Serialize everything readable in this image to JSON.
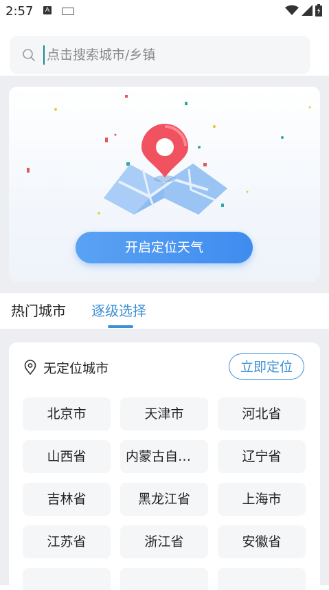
{
  "status": {
    "time": "2:57",
    "notification_icon_a": "A"
  },
  "search": {
    "placeholder": "点击搜索城市/乡镇"
  },
  "locate_card": {
    "button_label": "开启定位天气"
  },
  "tabs": [
    {
      "label": "热门城市",
      "active": false
    },
    {
      "label": "逐级选择",
      "active": true
    }
  ],
  "location": {
    "label": "无定位城市",
    "button_label": "立即定位"
  },
  "regions": [
    "北京市",
    "天津市",
    "河北省",
    "山西省",
    "内蒙古自治...",
    "辽宁省",
    "吉林省",
    "黑龙江省",
    "上海市",
    "江苏省",
    "浙江省",
    "安徽省"
  ],
  "colors": {
    "accent": "#3d8fd6",
    "button_gradient_start": "#5aa2f3",
    "button_gradient_end": "#3f8cf0",
    "background_band": "#eceef1",
    "pin_red": "#f0525f"
  }
}
